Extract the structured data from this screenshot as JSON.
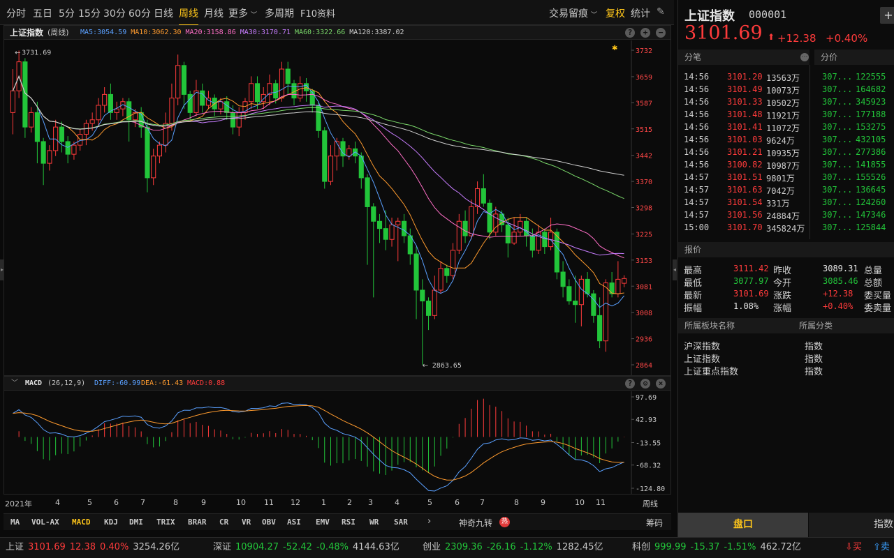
{
  "toolbar": {
    "periods": [
      "分时",
      "五日",
      "5分",
      "15分",
      "30分",
      "60分",
      "日线",
      "周线",
      "月线",
      "更多",
      "多周期",
      "F10资料"
    ],
    "active": "周线",
    "trace": "交易留痕",
    "fuquan": "复权",
    "stats": "统计"
  },
  "chart": {
    "name": "上证指数",
    "period": "(周线)",
    "ma": [
      {
        "label": "MA5:3054.59",
        "color": "#5aa0ff"
      },
      {
        "label": "MA10:3062.30",
        "color": "#ff9b2e"
      },
      {
        "label": "MA20:3158.86",
        "color": "#ff6ec7"
      },
      {
        "label": "MA30:3170.71",
        "color": "#c77dff"
      },
      {
        "label": "MA60:3322.66",
        "color": "#7bd96b"
      },
      {
        "label": "MA120:3387.02",
        "color": "#d0d0d0"
      }
    ],
    "y_ticks": [
      "3732",
      "3659",
      "3587",
      "3515",
      "3442",
      "3370",
      "3298",
      "3225",
      "3153",
      "3081",
      "3008",
      "2936",
      "2864"
    ],
    "high_label": "3731.69",
    "low_label": "2863.65"
  },
  "macd": {
    "name": "MACD",
    "params": "(26,12,9)",
    "diff": "DIFF:-60.99",
    "dea": "DEA:-61.43",
    "macd": "MACD:0.88",
    "y_ticks": [
      "97.69",
      "42.93",
      "-13.55",
      "-68.32",
      "-124.80"
    ]
  },
  "x_axis": {
    "labels": [
      "2021年",
      "4",
      "5",
      "6",
      "7",
      "8",
      "9",
      "10",
      "11",
      "12",
      "1",
      "2",
      "3",
      "4",
      "5",
      "6",
      "7",
      "8",
      "9",
      "10",
      "11"
    ],
    "period": "周线"
  },
  "indicators": {
    "tabs": [
      "MA",
      "VOL-AX",
      "MACD",
      "KDJ",
      "DMI",
      "TRIX",
      "BRAR",
      "CR",
      "VR",
      "OBV",
      "ASI",
      "EMV",
      "RSI",
      "WR",
      "SAR"
    ],
    "active": "MACD",
    "special": "神奇九转",
    "hot": "热",
    "chips": "筹码"
  },
  "status": [
    {
      "name": "上证",
      "price": "3101.69",
      "chg": "12.38",
      "pct": "0.40%",
      "amt": "3254.26亿",
      "dir": "up"
    },
    {
      "name": "深证",
      "price": "10904.27",
      "chg": "-52.42",
      "pct": "-0.48%",
      "amt": "4144.63亿",
      "dir": "down"
    },
    {
      "name": "创业",
      "price": "2309.36",
      "chg": "-26.16",
      "pct": "-1.12%",
      "amt": "1282.45亿",
      "dir": "down"
    },
    {
      "name": "科创",
      "price": "999.99",
      "chg": "-15.37",
      "pct": "-1.51%",
      "amt": "462.72亿",
      "dir": "down"
    }
  ],
  "status_buy": "买",
  "status_sell": "卖",
  "quote": {
    "name": "上证指数",
    "code": "000001",
    "price": "3101.69",
    "change": "+12.38",
    "pct": "+0.40%"
  },
  "ticks": {
    "title": "分笔",
    "rows": [
      [
        "14:56",
        "3101.20",
        "13563万"
      ],
      [
        "14:56",
        "3101.49",
        "10073万"
      ],
      [
        "14:56",
        "3101.33",
        "10502万"
      ],
      [
        "14:56",
        "3101.48",
        "11921万"
      ],
      [
        "14:56",
        "3101.41",
        "11072万"
      ],
      [
        "14:56",
        "3101.03",
        "9624万"
      ],
      [
        "14:56",
        "3101.21",
        "10935万"
      ],
      [
        "14:56",
        "3100.82",
        "10987万"
      ],
      [
        "14:57",
        "3101.51",
        "9801万"
      ],
      [
        "14:57",
        "3101.63",
        "7042万"
      ],
      [
        "14:57",
        "3101.54",
        "331万"
      ],
      [
        "14:57",
        "3101.56",
        "24884万"
      ],
      [
        "15:00",
        "3101.70",
        "345824万"
      ]
    ]
  },
  "fenjia": {
    "title": "分价",
    "rows": [
      [
        "307...",
        "122555"
      ],
      [
        "307...",
        "164682"
      ],
      [
        "307...",
        "345923"
      ],
      [
        "307...",
        "177188"
      ],
      [
        "307...",
        "153275"
      ],
      [
        "307...",
        "432105"
      ],
      [
        "307...",
        "277386"
      ],
      [
        "307...",
        "141855"
      ],
      [
        "307...",
        "155526"
      ],
      [
        "307...",
        "136645"
      ],
      [
        "307...",
        "124260"
      ],
      [
        "307...",
        "147346"
      ],
      [
        "307...",
        "125844"
      ]
    ]
  },
  "baojia": {
    "title": "报价",
    "rows": [
      [
        {
          "k": "最高",
          "v": "3111.42",
          "c": "red"
        },
        {
          "k": "昨收",
          "v": "3089.31",
          "c": "white"
        },
        {
          "k": "总量"
        }
      ],
      [
        {
          "k": "最低",
          "v": "3077.97",
          "c": "green"
        },
        {
          "k": "今开",
          "v": "3085.46",
          "c": "green"
        },
        {
          "k": "总额"
        }
      ],
      [
        {
          "k": "最新",
          "v": "3101.69",
          "c": "red"
        },
        {
          "k": "涨跌",
          "v": "+12.38",
          "c": "red"
        },
        {
          "k": "委买量"
        }
      ],
      [
        {
          "k": "振幅",
          "v": "1.08%",
          "c": "white"
        },
        {
          "k": "涨幅",
          "v": "+0.40%",
          "c": "red"
        },
        {
          "k": "委卖量"
        }
      ]
    ]
  },
  "sector": {
    "title": "所属板块名称",
    "cat_title": "所属分类",
    "rows": [
      [
        "沪深指数",
        "指数"
      ],
      [
        "上证指数",
        "指数"
      ],
      [
        "上证重点指数",
        "指数"
      ]
    ]
  },
  "bottom_tabs": [
    "盘口",
    "指数"
  ],
  "colors": {
    "up": "#ff3b3b",
    "down": "#22c53a",
    "accent": "#ffc61a"
  },
  "chart_data": {
    "type": "candlestick",
    "y_range": [
      2864,
      3732
    ],
    "note_free": true,
    "candles": [
      [
        3560,
        3620,
        3500,
        3680
      ],
      [
        3620,
        3700,
        3600,
        3731
      ],
      [
        3700,
        3520,
        3490,
        3710
      ],
      [
        3520,
        3560,
        3505,
        3575
      ],
      [
        3560,
        3480,
        3420,
        3590
      ],
      [
        3480,
        3420,
        3360,
        3490
      ],
      [
        3420,
        3455,
        3400,
        3470
      ],
      [
        3455,
        3520,
        3440,
        3540
      ],
      [
        3520,
        3480,
        3450,
        3535
      ],
      [
        3480,
        3445,
        3420,
        3495
      ],
      [
        3445,
        3470,
        3430,
        3480
      ],
      [
        3470,
        3500,
        3455,
        3515
      ],
      [
        3500,
        3530,
        3470,
        3540
      ],
      [
        3530,
        3540,
        3510,
        3560
      ],
      [
        3540,
        3580,
        3525,
        3600
      ],
      [
        3580,
        3610,
        3560,
        3630
      ],
      [
        3610,
        3560,
        3540,
        3640
      ],
      [
        3560,
        3570,
        3540,
        3590
      ],
      [
        3570,
        3590,
        3550,
        3600
      ],
      [
        3590,
        3540,
        3480,
        3600
      ],
      [
        3540,
        3560,
        3520,
        3570
      ],
      [
        3560,
        3520,
        3490,
        3575
      ],
      [
        3520,
        3380,
        3340,
        3540
      ],
      [
        3380,
        3440,
        3360,
        3460
      ],
      [
        3440,
        3470,
        3420,
        3480
      ],
      [
        3470,
        3530,
        3450,
        3560
      ],
      [
        3530,
        3600,
        3510,
        3640
      ],
      [
        3600,
        3690,
        3580,
        3720
      ],
      [
        3690,
        3610,
        3570,
        3700
      ],
      [
        3610,
        3560,
        3540,
        3620
      ],
      [
        3560,
        3620,
        3550,
        3650
      ],
      [
        3620,
        3580,
        3560,
        3640
      ],
      [
        3580,
        3600,
        3570,
        3620
      ],
      [
        3600,
        3570,
        3550,
        3610
      ],
      [
        3570,
        3590,
        3555,
        3600
      ],
      [
        3590,
        3560,
        3540,
        3605
      ],
      [
        3560,
        3520,
        3500,
        3580
      ],
      [
        3520,
        3560,
        3495,
        3575
      ],
      [
        3560,
        3590,
        3540,
        3600
      ],
      [
        3590,
        3640,
        3570,
        3660
      ],
      [
        3640,
        3590,
        3570,
        3660
      ],
      [
        3590,
        3610,
        3570,
        3630
      ],
      [
        3610,
        3640,
        3580,
        3665
      ],
      [
        3640,
        3600,
        3585,
        3650
      ],
      [
        3600,
        3680,
        3590,
        3700
      ],
      [
        3680,
        3640,
        3610,
        3700
      ],
      [
        3640,
        3600,
        3580,
        3650
      ],
      [
        3600,
        3640,
        3590,
        3660
      ],
      [
        3640,
        3620,
        3590,
        3655
      ],
      [
        3620,
        3580,
        3560,
        3625
      ],
      [
        3580,
        3510,
        3490,
        3590
      ],
      [
        3510,
        3370,
        3350,
        3520
      ],
      [
        3370,
        3440,
        3360,
        3470
      ],
      [
        3440,
        3480,
        3400,
        3490
      ],
      [
        3480,
        3440,
        3410,
        3490
      ],
      [
        3440,
        3460,
        3430,
        3470
      ],
      [
        3460,
        3440,
        3420,
        3480
      ],
      [
        3440,
        3380,
        3350,
        3450
      ],
      [
        3380,
        3300,
        3140,
        3390
      ],
      [
        3300,
        3260,
        3050,
        3310
      ],
      [
        3260,
        3240,
        3200,
        3280
      ],
      [
        3240,
        3210,
        3180,
        3290
      ],
      [
        3210,
        3250,
        3190,
        3270
      ],
      [
        3250,
        3260,
        3150,
        3270
      ],
      [
        3260,
        3220,
        3200,
        3280
      ],
      [
        3220,
        3170,
        3140,
        3240
      ],
      [
        3170,
        3070,
        2990,
        3190
      ],
      [
        3070,
        3040,
        2864,
        3100
      ],
      [
        3040,
        3000,
        2960,
        3050
      ],
      [
        3000,
        3070,
        2990,
        3110
      ],
      [
        3070,
        3130,
        3060,
        3150
      ],
      [
        3130,
        3110,
        3090,
        3140
      ],
      [
        3110,
        3180,
        3100,
        3200
      ],
      [
        3180,
        3260,
        3170,
        3280
      ],
      [
        3260,
        3220,
        3200,
        3290
      ],
      [
        3220,
        3300,
        3210,
        3320
      ],
      [
        3300,
        3350,
        3280,
        3370
      ],
      [
        3350,
        3310,
        3300,
        3390
      ],
      [
        3310,
        3230,
        3210,
        3320
      ],
      [
        3230,
        3280,
        3220,
        3300
      ],
      [
        3280,
        3250,
        3230,
        3290
      ],
      [
        3250,
        3200,
        3160,
        3270
      ],
      [
        3200,
        3230,
        3195,
        3270
      ],
      [
        3230,
        3260,
        3220,
        3280
      ],
      [
        3260,
        3220,
        3190,
        3270
      ],
      [
        3220,
        3180,
        3160,
        3240
      ],
      [
        3180,
        3230,
        3170,
        3250
      ],
      [
        3230,
        3190,
        3170,
        3240
      ],
      [
        3190,
        3230,
        3180,
        3270
      ],
      [
        3230,
        3120,
        3100,
        3240
      ],
      [
        3120,
        3080,
        3050,
        3150
      ],
      [
        3080,
        3040,
        3030,
        3100
      ],
      [
        3040,
        3030,
        2980,
        3110
      ],
      [
        3030,
        3100,
        2970,
        3110
      ],
      [
        3100,
        3060,
        3050,
        3120
      ],
      [
        3060,
        3000,
        2980,
        3070
      ],
      [
        3000,
        2930,
        2910,
        3050
      ],
      [
        2930,
        3090,
        2900,
        3100
      ],
      [
        3090,
        3060,
        3050,
        3120
      ],
      [
        3060,
        3100,
        3050,
        3150
      ],
      [
        3089,
        3102,
        3078,
        3111
      ]
    ],
    "ma_end_values": {
      "MA5": 3054.59,
      "MA10": 3062.3,
      "MA20": 3158.86,
      "MA30": 3170.71,
      "MA60": 3322.66,
      "MA120": 3387.02
    },
    "macd_range": [
      -124.8,
      97.69
    ],
    "macd_last": {
      "DIFF": -60.99,
      "DEA": -61.43,
      "MACD": 0.88
    }
  }
}
